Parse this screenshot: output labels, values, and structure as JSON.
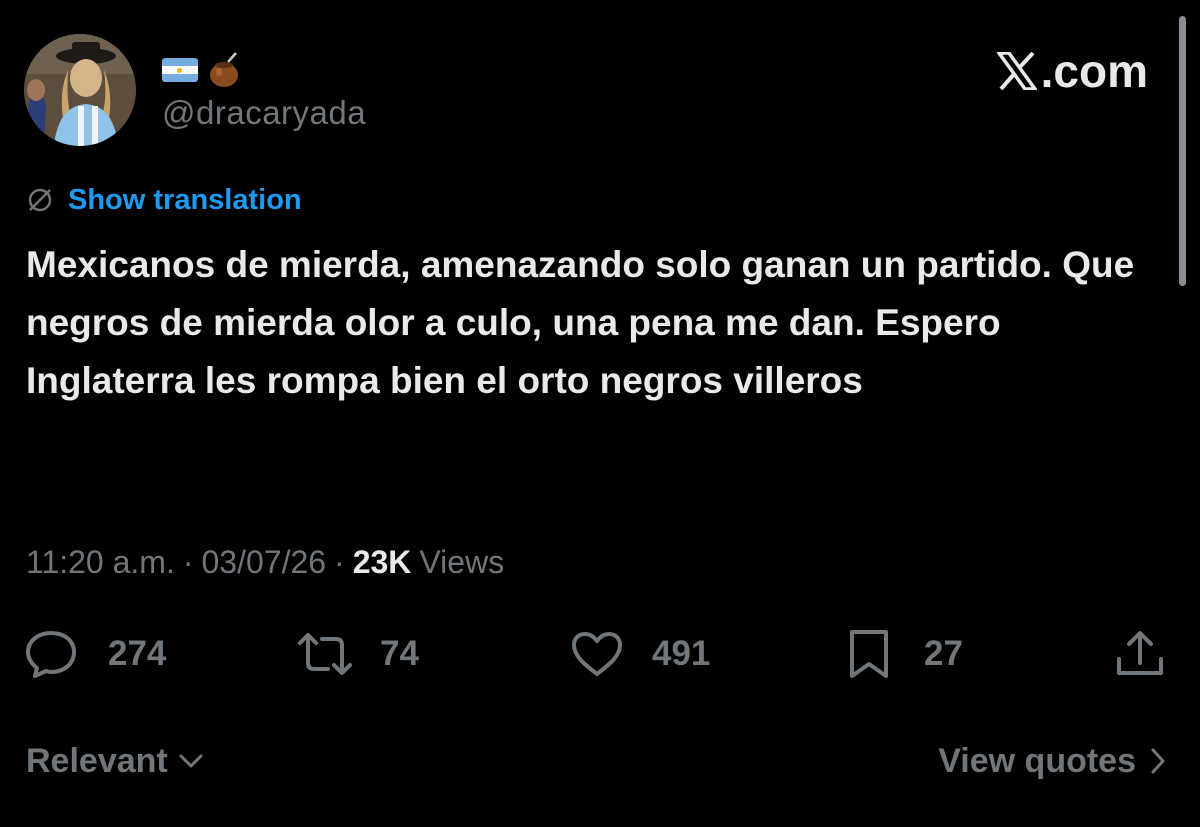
{
  "header": {
    "handle": "@dracaryada",
    "name_emojis": [
      "argentina-flag",
      "mate-gourd"
    ],
    "brand": "X.com",
    "brand_suffix": ".com"
  },
  "translation": {
    "label": "Show translation"
  },
  "tweet": {
    "text": "Mexicanos de mierda, amenazando solo ganan un partido. Que negros de mierda olor a culo, una pena me dan. Espero Inglaterra les rompa bien el orto negros villeros"
  },
  "meta": {
    "time": "11:20 a.m.",
    "date": "03/07/26",
    "views_count": "23K",
    "views_label": "Views"
  },
  "actions": {
    "replies": "274",
    "reposts": "74",
    "likes": "491",
    "bookmarks": "27"
  },
  "footer": {
    "sort_label": "Relevant",
    "view_quotes_label": "View quotes"
  },
  "colors": {
    "background": "#000000",
    "text": "#e7e9ea",
    "muted": "#71767b",
    "link": "#1d9bf0"
  }
}
